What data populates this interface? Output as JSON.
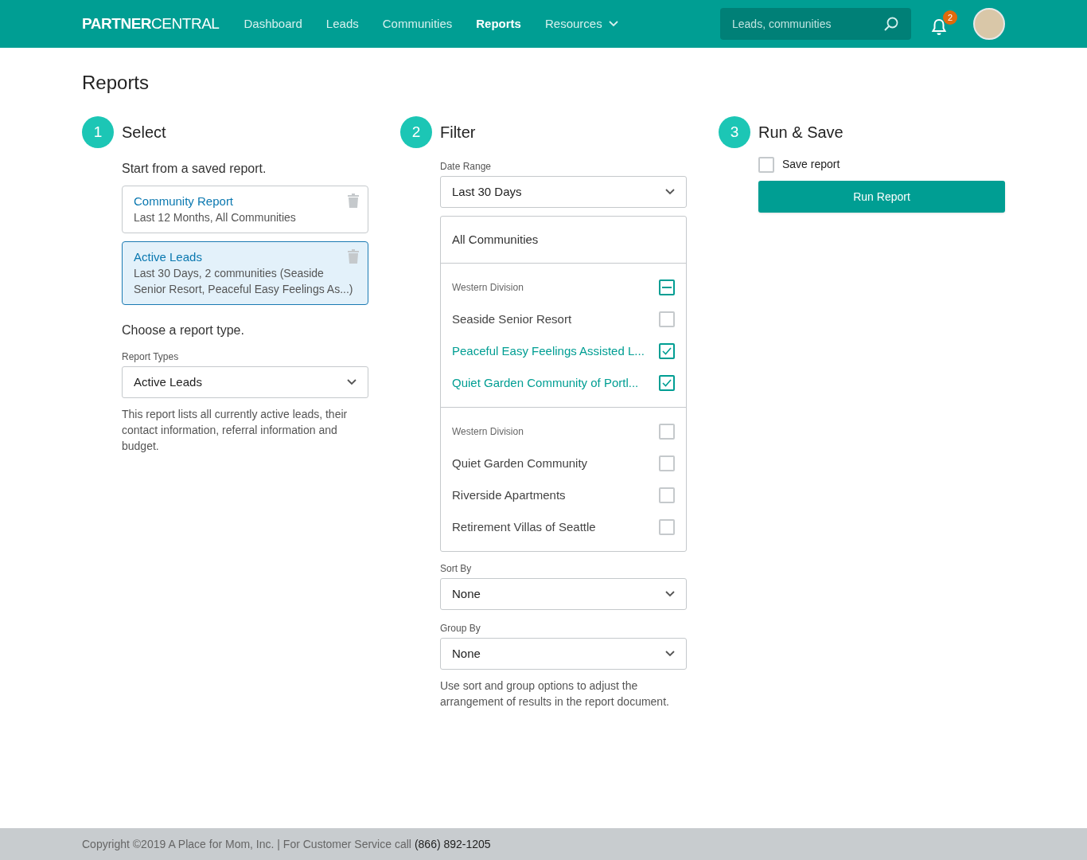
{
  "header": {
    "logo": "**PARTNER**CENTRAL",
    "nav": [
      {
        "label": "Dashboard",
        "selected": false,
        "has_menu": false
      },
      {
        "label": "Leads",
        "selected": false,
        "has_menu": false
      },
      {
        "label": "Communities",
        "selected": false,
        "has_menu": false
      },
      {
        "label": "Reports",
        "selected": true,
        "has_menu": false
      },
      {
        "label": "Resources",
        "selected": false,
        "has_menu": true
      }
    ],
    "search": {
      "placeholder": "Leads, communities"
    },
    "notifications": {
      "count": "2"
    }
  },
  "page_title": "Reports",
  "steps": [
    {
      "number": "1",
      "title": "Select"
    },
    {
      "number": "2",
      "title": "Filter"
    },
    {
      "number": "3",
      "title": "Run & Save"
    }
  ],
  "select": {
    "saved_heading": "Start from a saved report.",
    "saved_reports": [
      {
        "name": "Community Report",
        "details": "Last 12 Months, All Communities",
        "selected": false
      },
      {
        "name": "Active Leads",
        "details": "Last 30 Days, 2 communities (Seaside Senior Resort, Peaceful Easy Feelings As...)",
        "selected": true
      }
    ],
    "type_heading": "Choose a report type.",
    "type_label": "Report Types",
    "type_value": "Active Leads",
    "description": "This report lists all currently active leads, their contact information, referral information and budget."
  },
  "filter": {
    "date_label": "Date Range",
    "date_value": "Last 30 Days",
    "all_option": "All Communities",
    "groups": [
      {
        "label": "Western Division",
        "checked": false,
        "partial": true,
        "children": [
          {
            "label": "Seaside Senior Resort",
            "checked": false
          },
          {
            "label": "Peaceful Easy Feelings Assisted L...",
            "checked": true
          },
          {
            "label": "Quiet Garden Community of Portl...",
            "checked": true
          }
        ]
      },
      {
        "label": "Western Division",
        "checked": false,
        "partial": false,
        "children": [
          {
            "label": "Quiet Garden Community",
            "checked": false
          },
          {
            "label": "Riverside Apartments",
            "checked": false
          },
          {
            "label": "Retirement Villas of Seattle",
            "checked": false
          }
        ]
      }
    ],
    "sort_label": "Sort By",
    "sort_value": "None",
    "group_label": "Group By",
    "group_value": "None",
    "note": "Use sort and group options to adjust the arrangement of results in the report document."
  },
  "run": {
    "save_label": "Save report",
    "save_checked": false,
    "button": "Run Report"
  },
  "footer": {
    "copyright": "Copyright ©2019 A Place for Mom, Inc. | For Customer Service call",
    "phone": "(866) 892-1205"
  }
}
